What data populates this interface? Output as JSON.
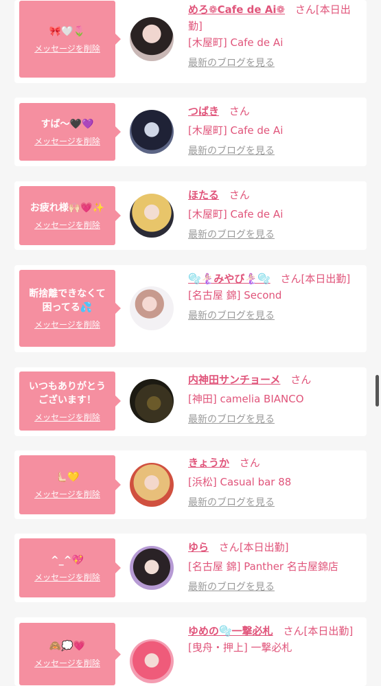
{
  "delete_label": "メッセージを削除",
  "blog_label": "最新のブログを見る",
  "suffix": "さん",
  "colors": {
    "accent": "#e0547a",
    "bubble": "#f58fa0"
  },
  "items": [
    {
      "message": "🎀🤍🌷",
      "name": "めろ❁Cafe de Ai❁",
      "status": "[本日出勤]",
      "shop": "[木屋町] Cafe de Ai"
    },
    {
      "message": "すば〜🖤💜",
      "name": "つばき",
      "status": "",
      "shop": "[木屋町] Cafe de Ai"
    },
    {
      "message": "お疲れ様🙌🏻💗✨",
      "name": "ほたる",
      "status": "",
      "shop": "[木屋町] Cafe de Ai"
    },
    {
      "message": "断捨離できなくて\n困ってる💦",
      "name": "🫧🧜🏻‍♀️みやび🧜🏻‍♀️🫧",
      "status": "[本日出勤]",
      "shop": "[名古屋 錦] Second"
    },
    {
      "message": "いつもありがとう\nございます！",
      "name": "内神田サンチョーメ",
      "status": "",
      "shop": "[神田] camelia BIANCO"
    },
    {
      "message": "🫷🏻💛",
      "name": "きょうか",
      "status": "",
      "shop": "[浜松] Casual bar 88"
    },
    {
      "message": "^_^💖",
      "name": "ゆら",
      "status": "[本日出勤]",
      "shop": "[名古屋 錦] Panther 名古屋錦店"
    },
    {
      "message": "🙈💭💗",
      "name": "ゆめの🫧一撃必札",
      "status": "[本日出勤]",
      "shop": "[曳舟・押上] 一撃必札"
    }
  ]
}
